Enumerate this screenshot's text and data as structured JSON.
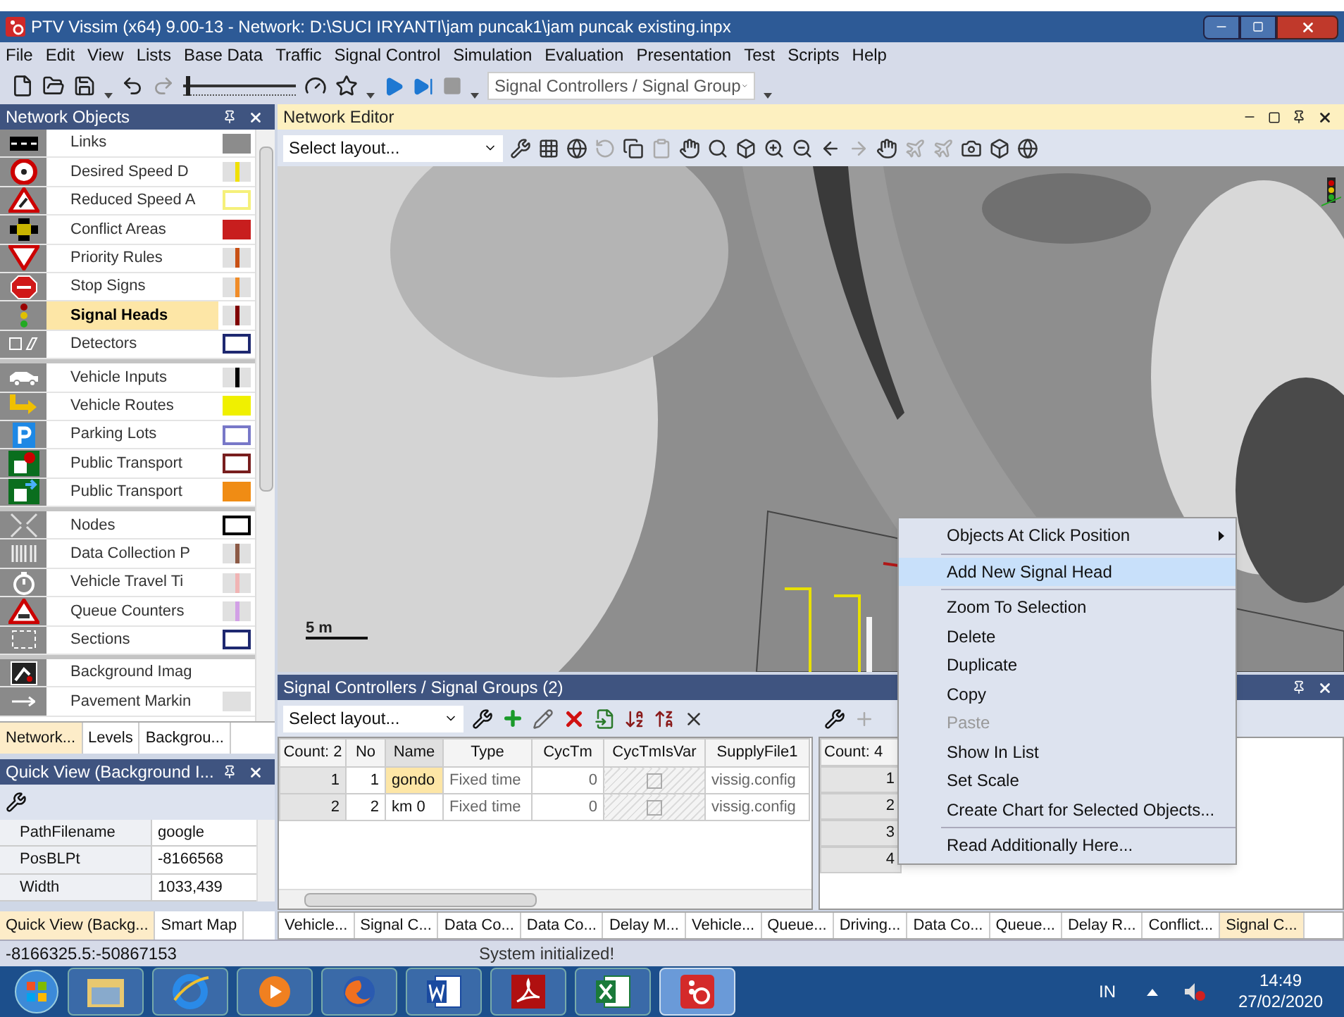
{
  "window": {
    "title": "PTV Vissim (x64) 9.00-13 - Network: D:\\SUCI IRYANTI\\jam puncak1\\jam puncak existing.inpx"
  },
  "menu": [
    "File",
    "Edit",
    "View",
    "Lists",
    "Base Data",
    "Traffic",
    "Signal Control",
    "Simulation",
    "Evaluation",
    "Presentation",
    "Test",
    "Scripts",
    "Help"
  ],
  "toolbar": {
    "speed_slider": {
      "level": 0.03
    },
    "dropdown": "Signal Controllers / Signal Group"
  },
  "network_objects": {
    "title": "Network Objects",
    "groups": [
      {
        "items": [
          {
            "label": "Links",
            "selected": false,
            "swatch": {
              "kind": "fill",
              "color": "#8c8c8c"
            }
          },
          {
            "label": "Desired Speed D",
            "selected": false,
            "swatch": {
              "kind": "line",
              "color": "#f0e000"
            }
          },
          {
            "label": "Reduced Speed A",
            "selected": false,
            "swatch": {
              "kind": "border",
              "color": "#f5f07a"
            }
          },
          {
            "label": "Conflict Areas",
            "selected": false,
            "swatch": {
              "kind": "fill",
              "color": "#c81e1e"
            }
          },
          {
            "label": "Priority Rules",
            "selected": false,
            "swatch": {
              "kind": "line",
              "color": "#c85014"
            }
          },
          {
            "label": "Stop Signs",
            "selected": false,
            "swatch": {
              "kind": "line",
              "color": "#f08c28"
            }
          },
          {
            "label": "Signal Heads",
            "selected": true,
            "swatch": {
              "kind": "line",
              "color": "#800000"
            }
          },
          {
            "label": "Detectors",
            "selected": false,
            "swatch": {
              "kind": "border",
              "color": "#1e2870"
            }
          }
        ]
      },
      {
        "items": [
          {
            "label": "Vehicle Inputs",
            "selected": false,
            "swatch": {
              "kind": "line",
              "color": "#000000"
            }
          },
          {
            "label": "Vehicle Routes",
            "selected": false,
            "swatch": {
              "kind": "fill",
              "color": "#f0f000"
            }
          },
          {
            "label": "Parking Lots",
            "selected": false,
            "swatch": {
              "kind": "border",
              "color": "#7878c8"
            }
          },
          {
            "label": "Public Transport",
            "selected": false,
            "swatch": {
              "kind": "border",
              "color": "#781e1e"
            }
          },
          {
            "label": "Public Transport",
            "selected": false,
            "swatch": {
              "kind": "fill",
              "color": "#f08c14"
            }
          }
        ]
      },
      {
        "items": [
          {
            "label": "Nodes",
            "selected": false,
            "swatch": {
              "kind": "border",
              "color": "#000000"
            }
          },
          {
            "label": "Data Collection P",
            "selected": false,
            "swatch": {
              "kind": "line",
              "color": "#8c5a46"
            }
          },
          {
            "label": "Vehicle Travel Ti",
            "selected": false,
            "swatch": {
              "kind": "line",
              "color": "#f0b4b4"
            }
          },
          {
            "label": "Queue Counters",
            "selected": false,
            "swatch": {
              "kind": "line",
              "color": "#d2a0e6"
            }
          },
          {
            "label": "Sections",
            "selected": false,
            "swatch": {
              "kind": "border",
              "color": "#1e2870"
            }
          }
        ]
      },
      {
        "items": [
          {
            "label": "Background Imag",
            "selected": false
          },
          {
            "label": "Pavement Markin",
            "selected": false,
            "swatch": {
              "kind": "fill",
              "color": "#e0e0e0"
            }
          }
        ]
      }
    ]
  },
  "left_tabs": [
    {
      "label": "Network...",
      "selected": true
    },
    {
      "label": "Levels",
      "selected": false
    },
    {
      "label": "Backgrou...",
      "selected": false
    }
  ],
  "quick_view": {
    "title": "Quick View (Background I...",
    "rows": [
      {
        "name": "PathFilename",
        "value": "google"
      },
      {
        "name": "PosBLPt",
        "value": "-8166568"
      },
      {
        "name": "Width",
        "value": "1033,439"
      }
    ],
    "tabs": [
      {
        "label": "Quick View (Backg...",
        "selected": true
      },
      {
        "label": "Smart Map",
        "selected": false
      }
    ]
  },
  "network_editor": {
    "title": "Network Editor",
    "layout_placeholder": "Select layout...",
    "scale": "5 m"
  },
  "signal_controllers": {
    "title": "Signal Controllers / Signal Groups (2)",
    "layout_placeholder": "Select layout...",
    "columns": [
      "Count: 2",
      "No",
      "Name",
      "Type",
      "CycTm",
      "CycTmIsVar",
      "SupplyFile1"
    ],
    "rows": [
      {
        "index": "1",
        "no": "1",
        "name": "gondo",
        "type": "Fixed time",
        "cyc_tm": "0",
        "cyc_tm_is_var": false,
        "supply_file": "vissig.config",
        "selected": true
      },
      {
        "index": "2",
        "no": "2",
        "name": "km 0",
        "type": "Fixed time",
        "cyc_tm": "0",
        "cyc_tm_is_var": false,
        "supply_file": "vissig.config",
        "selected": false
      }
    ]
  },
  "signal_groups": {
    "count": "Count: 4",
    "rows": [
      "1",
      "2",
      "3",
      "4"
    ]
  },
  "bottom_tabs": [
    {
      "label": "Vehicle...",
      "selected": false
    },
    {
      "label": "Signal C...",
      "selected": false
    },
    {
      "label": "Data Co...",
      "selected": false
    },
    {
      "label": "Data Co...",
      "selected": false
    },
    {
      "label": "Delay M...",
      "selected": false
    },
    {
      "label": "Vehicle...",
      "selected": false
    },
    {
      "label": "Queue...",
      "selected": false
    },
    {
      "label": "Driving...",
      "selected": false
    },
    {
      "label": "Data Co...",
      "selected": false
    },
    {
      "label": "Queue...",
      "selected": false
    },
    {
      "label": "Delay R...",
      "selected": false
    },
    {
      "label": "Conflict...",
      "selected": false
    },
    {
      "label": "Signal C...",
      "selected": true
    }
  ],
  "status_bar": {
    "coordinates": "-8166325.5:-50867153",
    "message": "System initialized!"
  },
  "context_menu": {
    "groups": [
      {
        "items": [
          {
            "label": "Objects At Click Position",
            "submenu": true,
            "selected": false,
            "disabled": false
          }
        ]
      },
      {
        "items": [
          {
            "label": "Add New Signal Head",
            "submenu": false,
            "selected": true,
            "disabled": false
          }
        ]
      },
      {
        "items": [
          {
            "label": "Zoom To Selection",
            "submenu": false,
            "selected": false,
            "disabled": false
          },
          {
            "label": "Delete",
            "submenu": false,
            "selected": false,
            "disabled": false
          },
          {
            "label": "Duplicate",
            "submenu": false,
            "selected": false,
            "disabled": false
          },
          {
            "label": "Copy",
            "submenu": false,
            "selected": false,
            "disabled": false
          },
          {
            "label": "Paste",
            "submenu": false,
            "selected": false,
            "disabled": true
          },
          {
            "label": "Show In List",
            "submenu": false,
            "selected": false,
            "disabled": false
          },
          {
            "label": "Set Scale",
            "submenu": false,
            "selected": false,
            "disabled": false
          },
          {
            "label": "Create Chart for Selected Objects...",
            "submenu": false,
            "selected": false,
            "disabled": false
          }
        ]
      },
      {
        "items": [
          {
            "label": "Read Additionally Here...",
            "submenu": false,
            "selected": false,
            "disabled": false
          }
        ]
      }
    ]
  },
  "taskbar": {
    "apps": [
      {
        "selected": false
      },
      {
        "selected": false
      },
      {
        "selected": false
      },
      {
        "selected": false
      },
      {
        "selected": false
      },
      {
        "selected": false
      },
      {
        "selected": false
      },
      {
        "selected": true
      }
    ],
    "tray": {
      "language": "IN",
      "time": "14:49",
      "date": "27/02/2020"
    }
  }
}
